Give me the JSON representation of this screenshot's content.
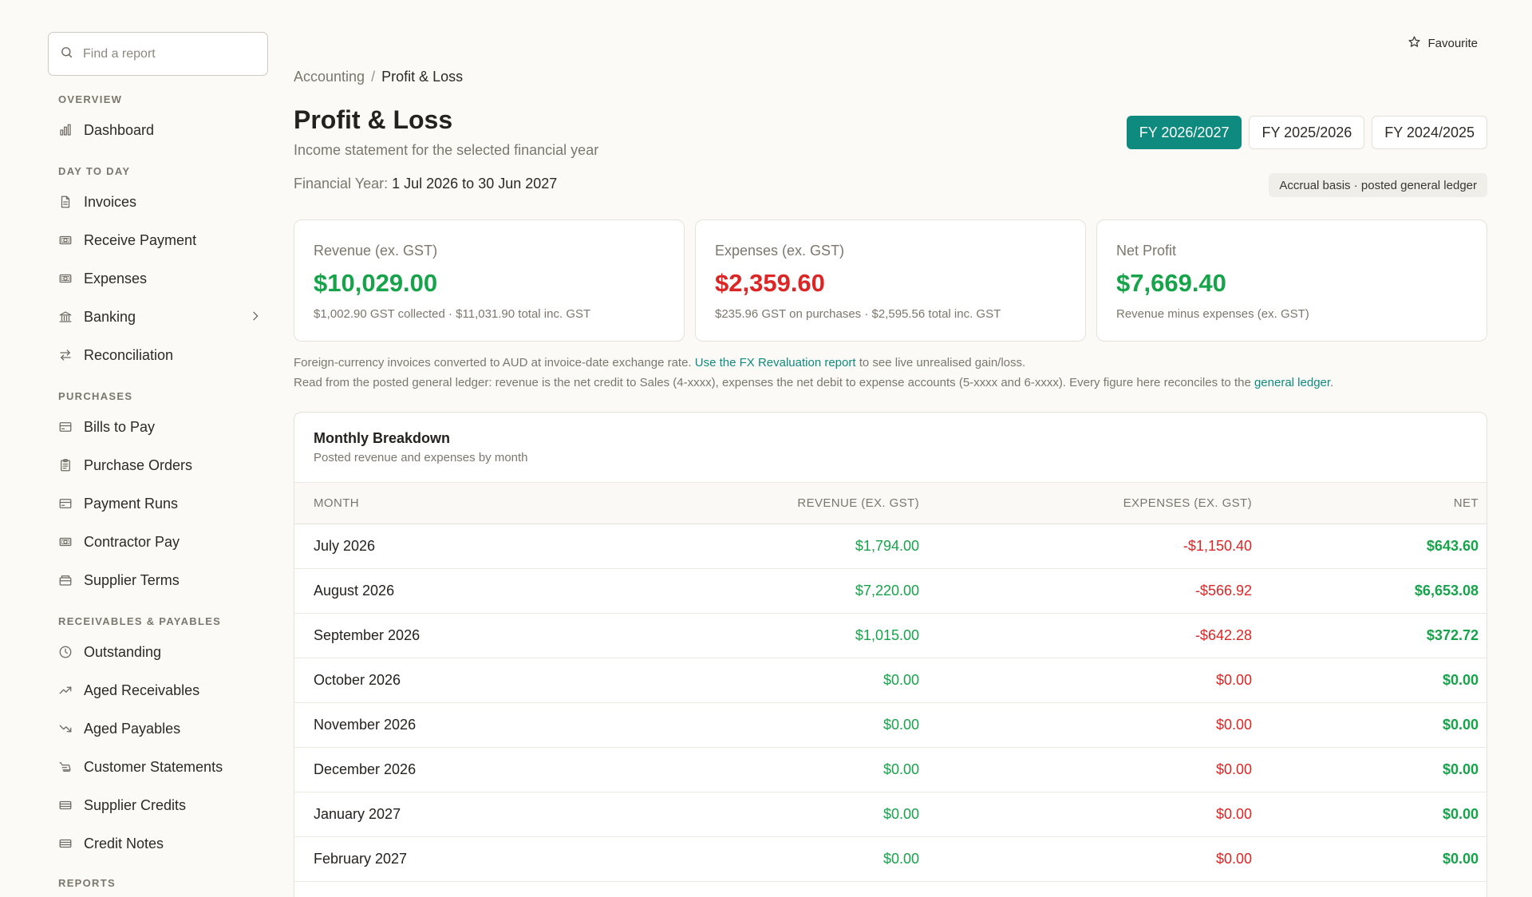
{
  "sidebar": {
    "search_placeholder": "Find a report",
    "sections": [
      {
        "title": "OVERVIEW",
        "items": [
          {
            "label": "Dashboard",
            "icon": "bar-chart-icon"
          }
        ]
      },
      {
        "title": "DAY TO DAY",
        "items": [
          {
            "label": "Invoices",
            "icon": "document-icon"
          },
          {
            "label": "Receive Payment",
            "icon": "banknote-icon"
          },
          {
            "label": "Expenses",
            "icon": "banknote-icon"
          },
          {
            "label": "Banking",
            "icon": "bank-icon",
            "has_chevron": true
          },
          {
            "label": "Reconciliation",
            "icon": "arrows-exchange-icon"
          }
        ]
      },
      {
        "title": "PURCHASES",
        "items": [
          {
            "label": "Bills to Pay",
            "icon": "credit-card-icon"
          },
          {
            "label": "Purchase Orders",
            "icon": "clipboard-icon"
          },
          {
            "label": "Payment Runs",
            "icon": "credit-card-icon"
          },
          {
            "label": "Contractor Pay",
            "icon": "banknote-icon"
          },
          {
            "label": "Supplier Terms",
            "icon": "wallet-icon"
          }
        ]
      },
      {
        "title": "RECEIVABLES & PAYABLES",
        "items": [
          {
            "label": "Outstanding",
            "icon": "clock-icon"
          },
          {
            "label": "Aged Receivables",
            "icon": "trending-up-icon"
          },
          {
            "label": "Aged Payables",
            "icon": "trending-down-icon"
          },
          {
            "label": "Customer Statements",
            "icon": "receipt-icon"
          },
          {
            "label": "Supplier Credits",
            "icon": "card-stack-icon"
          },
          {
            "label": "Credit Notes",
            "icon": "card-stack-icon"
          }
        ]
      },
      {
        "title": "REPORTS",
        "items": []
      }
    ]
  },
  "header": {
    "favourite_label": "Favourite",
    "breadcrumb": {
      "parent": "Accounting",
      "separator": "/",
      "current": "Profit & Loss"
    },
    "title": "Profit & Loss",
    "subtitle": "Income statement for the selected financial year",
    "fy_prefix": "Financial Year:",
    "fy_value": "1 Jul 2026 to 30 Jun 2027",
    "fy_tabs": [
      {
        "label": "FY 2026/2027",
        "active": true
      },
      {
        "label": "FY 2025/2026",
        "active": false
      },
      {
        "label": "FY 2024/2025",
        "active": false
      }
    ],
    "basis_badge": "Accrual basis · posted general ledger"
  },
  "cards": [
    {
      "label": "Revenue (ex. GST)",
      "value": "$10,029.00",
      "sub": "$1,002.90 GST collected · $11,031.90 total inc. GST",
      "tone": "green"
    },
    {
      "label": "Expenses (ex. GST)",
      "value": "$2,359.60",
      "sub": "$235.96 GST on purchases · $2,595.56 total inc. GST",
      "tone": "red"
    },
    {
      "label": "Net Profit",
      "value": "$7,669.40",
      "sub": "Revenue minus expenses (ex. GST)",
      "tone": "green"
    }
  ],
  "notes": {
    "line1_pre": "Foreign-currency invoices converted to AUD at invoice-date exchange rate.",
    "line1_link": "Use the FX Revaluation report",
    "line1_post": "to see live unrealised gain/loss.",
    "line2_pre": "Read from the posted general ledger: revenue is the net credit to Sales (4-xxxx), expenses the net debit to expense accounts (5-xxxx and 6-xxxx). Every figure here reconciles to the",
    "line2_link": "general ledger",
    "line2_post": "."
  },
  "breakdown": {
    "title": "Monthly Breakdown",
    "subtitle": "Posted revenue and expenses by month",
    "columns": [
      "MONTH",
      "REVENUE (EX. GST)",
      "EXPENSES (EX. GST)",
      "NET"
    ],
    "rows": [
      {
        "month": "July 2026",
        "revenue": "$1,794.00",
        "expenses": "-$1,150.40",
        "net": "$643.60"
      },
      {
        "month": "August 2026",
        "revenue": "$7,220.00",
        "expenses": "-$566.92",
        "net": "$6,653.08"
      },
      {
        "month": "September 2026",
        "revenue": "$1,015.00",
        "expenses": "-$642.28",
        "net": "$372.72"
      },
      {
        "month": "October 2026",
        "revenue": "$0.00",
        "expenses": "$0.00",
        "net": "$0.00"
      },
      {
        "month": "November 2026",
        "revenue": "$0.00",
        "expenses": "$0.00",
        "net": "$0.00"
      },
      {
        "month": "December 2026",
        "revenue": "$0.00",
        "expenses": "$0.00",
        "net": "$0.00"
      },
      {
        "month": "January 2027",
        "revenue": "$0.00",
        "expenses": "$0.00",
        "net": "$0.00"
      },
      {
        "month": "February 2027",
        "revenue": "$0.00",
        "expenses": "$0.00",
        "net": "$0.00"
      }
    ]
  },
  "colors": {
    "accent": "#0f8a7e",
    "positive": "#16a34a",
    "negative": "#dc2626"
  }
}
